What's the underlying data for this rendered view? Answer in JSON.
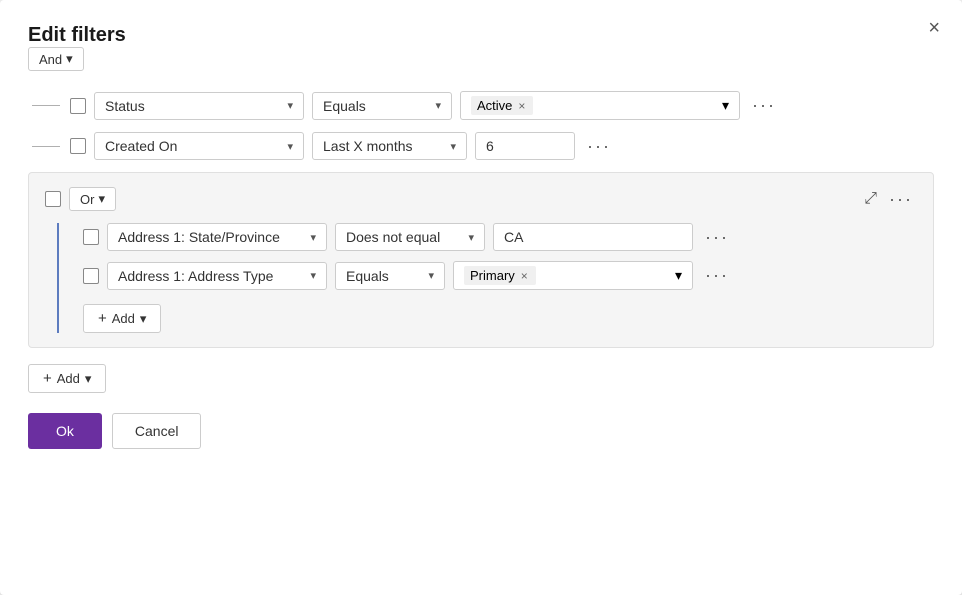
{
  "dialog": {
    "title": "Edit filters",
    "close_label": "×"
  },
  "and_group": {
    "label": "And",
    "chevron": "▾"
  },
  "row1": {
    "field": "Status",
    "operator": "Equals",
    "value_tag": "Active",
    "chevron": "▾",
    "ellipsis": "···"
  },
  "row2": {
    "field": "Created On",
    "operator": "Last X months",
    "value": "6",
    "chevron": "▾",
    "ellipsis": "···"
  },
  "or_group": {
    "or_label": "Or",
    "chevron": "▾",
    "collapse_icon": "⤢",
    "ellipsis": "···",
    "row1": {
      "field": "Address 1: State/Province",
      "operator": "Does not equal",
      "value": "CA",
      "chevron": "▾",
      "ellipsis": "···"
    },
    "row2": {
      "field": "Address 1: Address Type",
      "operator": "Equals",
      "value_tag": "Primary",
      "chevron": "▾",
      "ellipsis": "···"
    },
    "add_label": "Add",
    "add_chevron": "▾"
  },
  "bottom_add": {
    "label": "Add",
    "chevron": "▾"
  },
  "footer": {
    "ok_label": "Ok",
    "cancel_label": "Cancel"
  }
}
